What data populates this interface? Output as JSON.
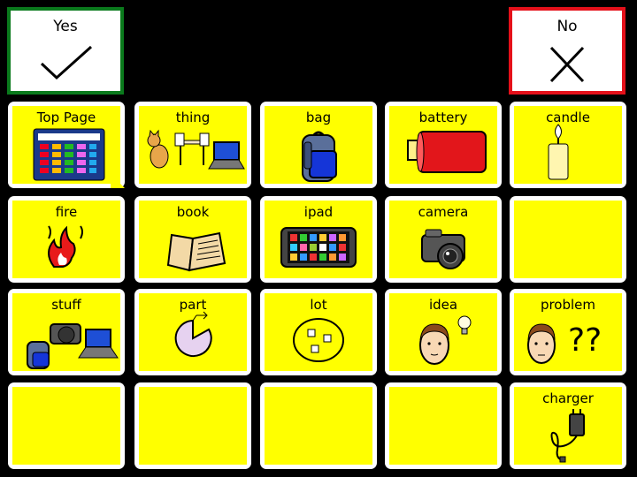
{
  "top": {
    "yes_label": "Yes",
    "no_label": "No"
  },
  "grid": {
    "row1": [
      "Top Page",
      "thing",
      "bag",
      "battery",
      "candle"
    ],
    "row2": [
      "fire",
      "book",
      "ipad",
      "camera",
      ""
    ],
    "row3": [
      "stuff",
      "part",
      "lot",
      "idea",
      "problem"
    ],
    "row4": [
      "",
      "",
      "",
      "",
      "charger"
    ]
  },
  "colors": {
    "yes_border": "#0a7a1c",
    "no_border": "#e5101a",
    "cell_fill": "#ffff00"
  },
  "icons": {
    "Top Page": "home-grid-icon",
    "thing": "things-icon",
    "bag": "backpack-icon",
    "battery": "battery-icon",
    "candle": "candle-icon",
    "fire": "fire-icon",
    "book": "book-icon",
    "ipad": "tablet-icon",
    "camera": "camera-icon",
    "stuff": "stuff-icon",
    "part": "pie-part-icon",
    "lot": "lot-icon",
    "idea": "idea-icon",
    "problem": "problem-icon",
    "charger": "charger-icon"
  }
}
